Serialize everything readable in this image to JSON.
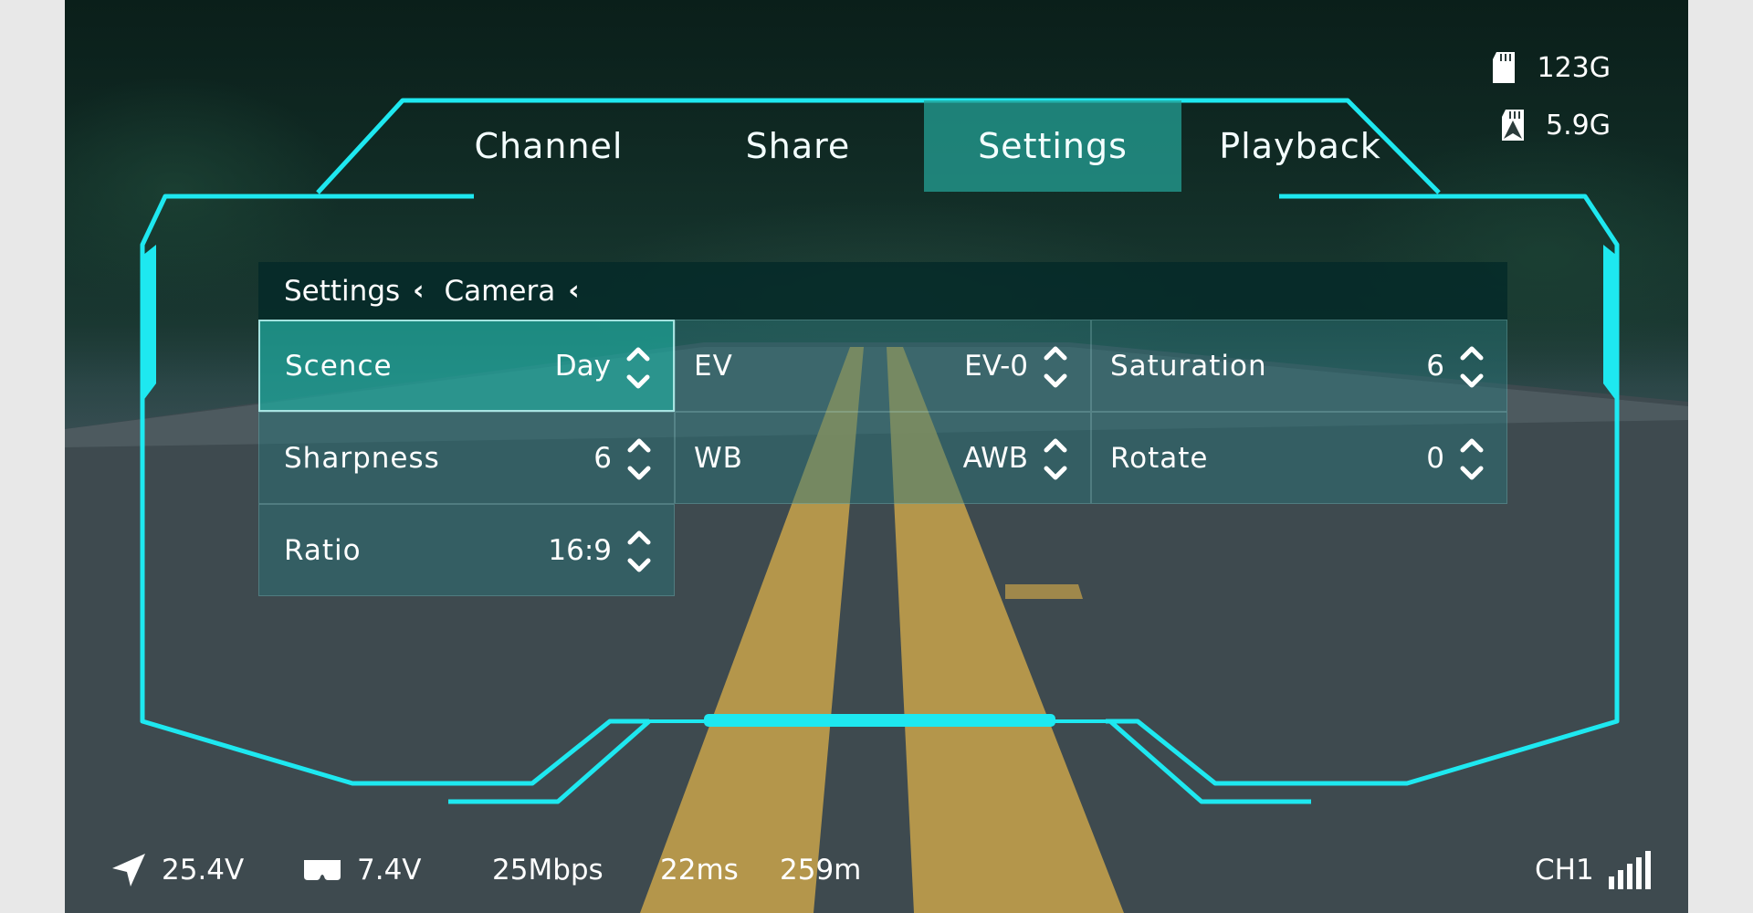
{
  "tabs": [
    {
      "label": "Channel",
      "active": false
    },
    {
      "label": "Share",
      "active": false
    },
    {
      "label": "Settings",
      "active": true
    },
    {
      "label": "Playback",
      "active": false
    }
  ],
  "storage": {
    "sd_card": {
      "icon": "sd-card-icon",
      "value": "123G"
    },
    "recorded": {
      "icon": "sd-card-upload-icon",
      "value": "5.9G"
    }
  },
  "breadcrumb": {
    "level1": "Settings",
    "level2": "Camera"
  },
  "settings": [
    {
      "label": "Scence",
      "value": "Day",
      "selected": true
    },
    {
      "label": "EV",
      "value": "EV-0",
      "selected": false
    },
    {
      "label": "Saturation",
      "value": "6",
      "selected": false
    },
    {
      "label": "Sharpness",
      "value": "6",
      "selected": false
    },
    {
      "label": "WB",
      "value": "AWB",
      "selected": false
    },
    {
      "label": "Rotate",
      "value": "0",
      "selected": false
    },
    {
      "label": "Ratio",
      "value": "16:9",
      "selected": false
    }
  ],
  "status": {
    "battery_drone": "25.4V",
    "battery_goggles": "7.4V",
    "bitrate": "25Mbps",
    "latency": "22ms",
    "distance": "259m",
    "channel": "CH1",
    "signal_bars": 5
  },
  "colors": {
    "accent": "#1ee8f0",
    "tab_active": "#24a096"
  }
}
